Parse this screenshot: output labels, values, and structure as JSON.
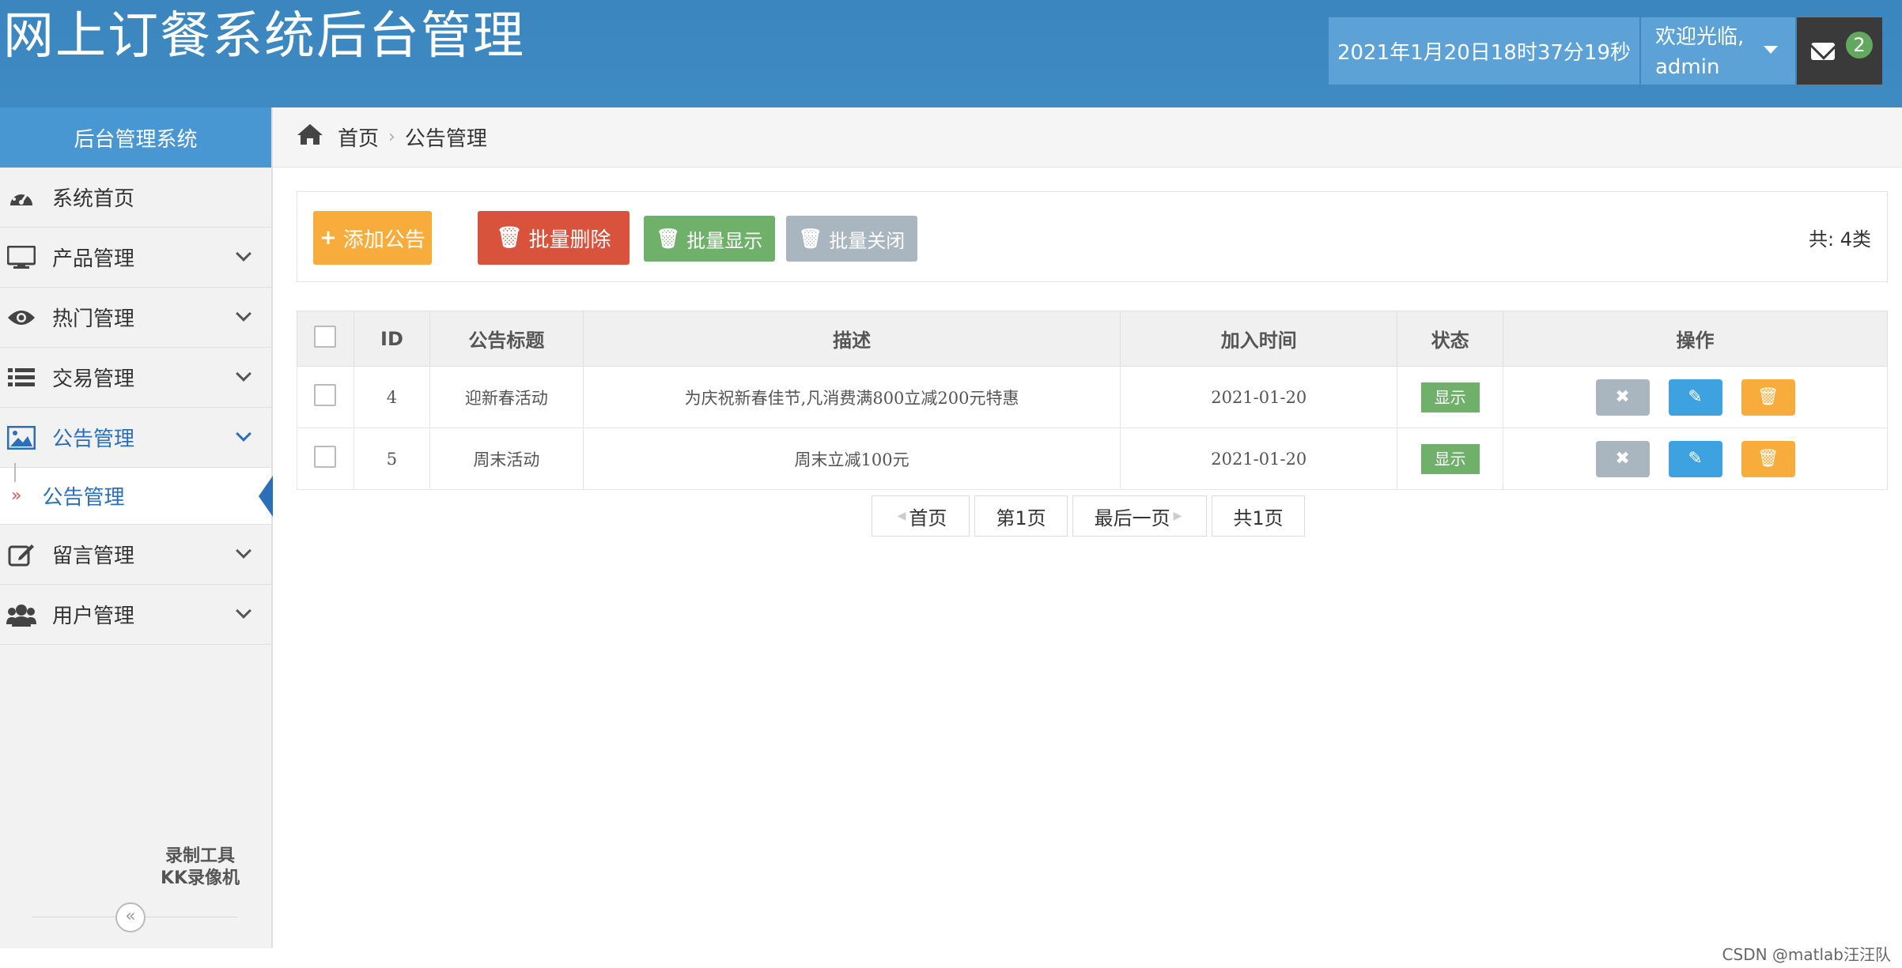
{
  "header": {
    "title": "网上订餐系统后台管理",
    "datetime": "2021年1月20日18时37分19秒",
    "welcome": "欢迎光临,",
    "username": "admin",
    "mail_count": "2"
  },
  "sidebar": {
    "title": "后台管理系统",
    "items": [
      {
        "label": "系统首页",
        "icon": "dashboard-icon"
      },
      {
        "label": "产品管理",
        "icon": "monitor-icon"
      },
      {
        "label": "热门管理",
        "icon": "eye-icon"
      },
      {
        "label": "交易管理",
        "icon": "list-icon"
      },
      {
        "label": "公告管理",
        "icon": "picture-icon"
      },
      {
        "label": "留言管理",
        "icon": "edit-icon"
      },
      {
        "label": "用户管理",
        "icon": "users-icon"
      }
    ],
    "sub_item": "公告管理",
    "watermark_line1": "录制工具",
    "watermark_line2": "KK录像机",
    "collapse": "«"
  },
  "breadcrumb": {
    "home": "首页",
    "current": "公告管理"
  },
  "toolbar": {
    "add_label": "添加公告",
    "delete_label": "批量删除",
    "show_label": "批量显示",
    "hide_label": "批量关闭",
    "total": "共:  4类"
  },
  "table": {
    "headers": [
      "ID",
      "公告标题",
      "描述",
      "加入时间",
      "状态",
      "操作"
    ],
    "rows": [
      {
        "id": "4",
        "title": "迎新春活动",
        "desc": "为庆祝新春佳节,凡消费满800立减200元特惠",
        "date": "2021-01-20",
        "status": "显示"
      },
      {
        "id": "5",
        "title": "周末活动",
        "desc": "周末立减100元",
        "date": "2021-01-20",
        "status": "显示"
      }
    ]
  },
  "pager": {
    "first": "首页",
    "current": "第1页",
    "last": "最后一页",
    "total": "共1页"
  },
  "footer": {
    "credit": "CSDN @matlab汪汪队"
  },
  "colors": {
    "header_bg": "#3f8ac3",
    "accent": "#4896d2",
    "orange": "#f8ac3b",
    "red": "#d9533c",
    "green": "#6fb06b",
    "gray": "#a9b5bf",
    "blue": "#3ea1e0"
  }
}
